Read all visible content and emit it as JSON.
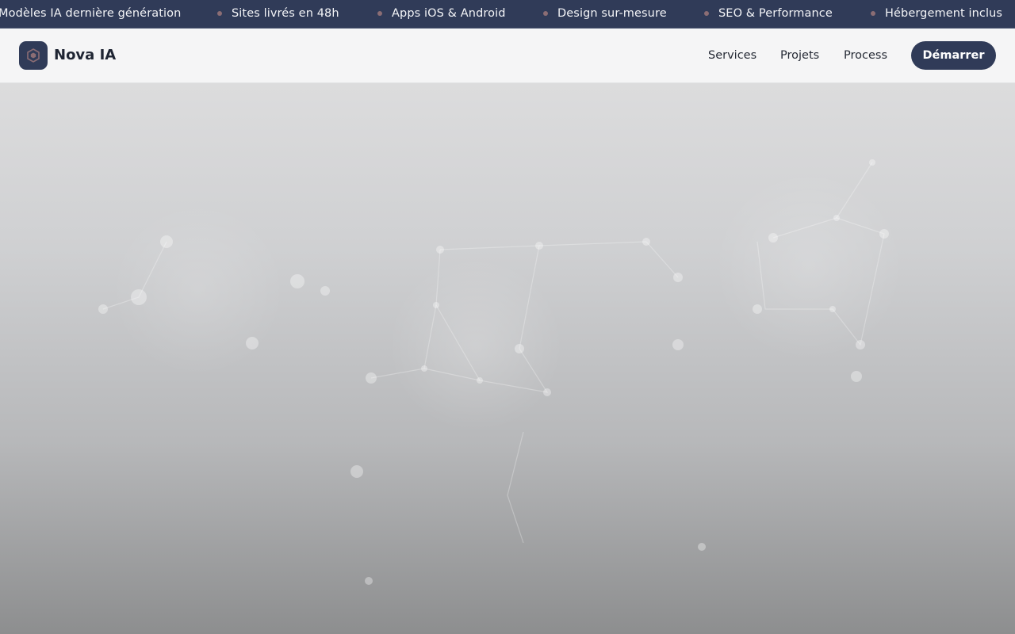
{
  "ticker": {
    "items": [
      "Modèles IA dernière génération",
      "Sites livrés en 48h",
      "Apps iOS & Android",
      "Design sur-mesure",
      "SEO & Performance",
      "Hébergement inclus"
    ],
    "dot_color": "#8b6d74",
    "background": "#303b58"
  },
  "header": {
    "brand": "Nova IA",
    "logo_icon": "hexagon-icon",
    "nav": [
      "Services",
      "Projets",
      "Process"
    ],
    "cta": "Démarrer"
  },
  "hero": {
    "background_image": "neural-network-illustration"
  },
  "colors": {
    "primary": "#303b58",
    "accent": "#8b6d74",
    "navbar_bg": "#f5f5f6"
  }
}
